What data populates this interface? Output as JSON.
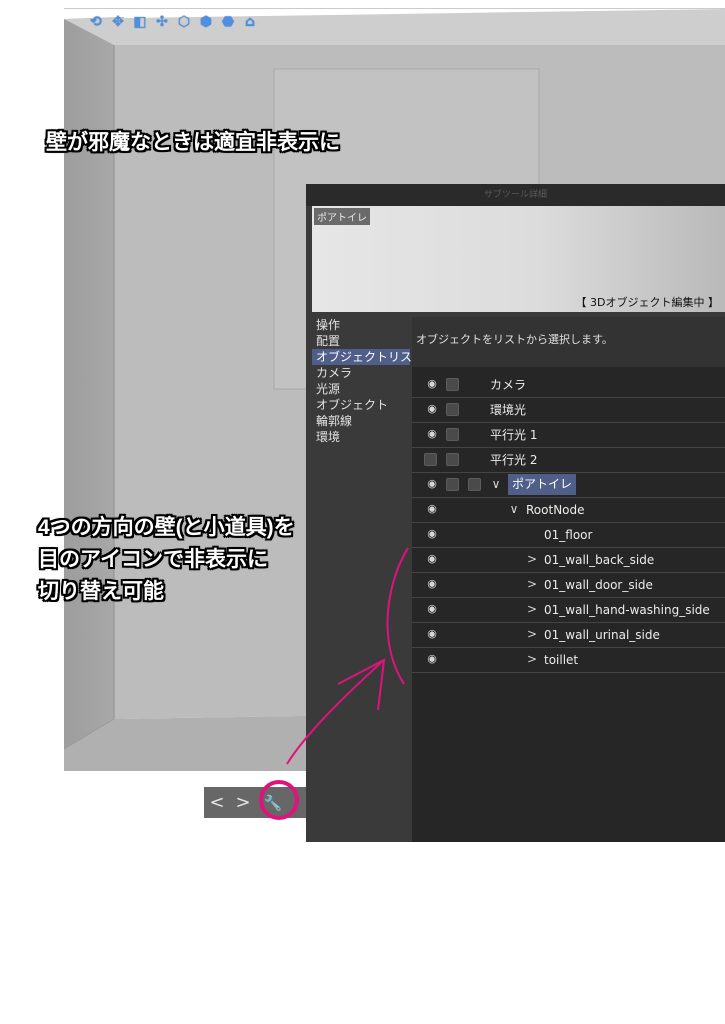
{
  "toolbar_icons": [
    "camera-move-icon",
    "pan-icon",
    "zoom-icon",
    "rotate-icon",
    "object-rotate-icon",
    "object-pan-icon",
    "object-zoom-icon",
    "object-reset-icon"
  ],
  "captions": {
    "top": "壁が邪魔なときは適宜非表示に",
    "lines": [
      "4つの方向の壁(と小道具)を",
      "目のアイコンで非表示に",
      "切り替え可能"
    ]
  },
  "nav": {
    "prev": "<",
    "next": ">",
    "wrench": "wrench-icon"
  },
  "panel": {
    "title": "サブツール詳細",
    "preview_tag": "ポアトイレ",
    "preview_status": "【 3Dオブジェクト編集中 】",
    "categories": [
      {
        "label": "操作",
        "selected": false
      },
      {
        "label": "配置",
        "selected": false
      },
      {
        "label": "オブジェクトリスト",
        "selected": true
      },
      {
        "label": "カメラ",
        "selected": false
      },
      {
        "label": "光源",
        "selected": false
      },
      {
        "label": "オブジェクト",
        "selected": false
      },
      {
        "label": "輪郭線",
        "selected": false
      },
      {
        "label": "環境",
        "selected": false
      }
    ],
    "hint": "オブジェクトをリストから選択します。",
    "objects": [
      {
        "label": "カメラ",
        "eye": true,
        "boxes": 1,
        "chevron": "",
        "indent": 0,
        "selected": false
      },
      {
        "label": "環境光",
        "eye": true,
        "boxes": 1,
        "chevron": "",
        "indent": 0,
        "selected": false
      },
      {
        "label": "平行光 1",
        "eye": true,
        "boxes": 1,
        "chevron": "",
        "indent": 0,
        "selected": false
      },
      {
        "label": "平行光 2",
        "eye": false,
        "boxes": 2,
        "chevron": "",
        "indent": 0,
        "selected": false
      },
      {
        "label": "ポアトイレ",
        "eye": true,
        "boxes": 2,
        "chevron": "down",
        "indent": 0,
        "selected": true
      },
      {
        "label": "RootNode",
        "eye": true,
        "boxes": 0,
        "chevron": "down",
        "indent": 1,
        "selected": false
      },
      {
        "label": "01_floor",
        "eye": true,
        "boxes": 0,
        "chevron": "",
        "indent": 2,
        "selected": false
      },
      {
        "label": "01_wall_back_side",
        "eye": true,
        "boxes": 0,
        "chevron": "right",
        "indent": 2,
        "selected": false
      },
      {
        "label": "01_wall_door_side",
        "eye": true,
        "boxes": 0,
        "chevron": "right",
        "indent": 2,
        "selected": false
      },
      {
        "label": "01_wall_hand-washing_side",
        "eye": true,
        "boxes": 0,
        "chevron": "right",
        "indent": 2,
        "selected": false
      },
      {
        "label": "01_wall_urinal_side",
        "eye": true,
        "boxes": 0,
        "chevron": "right",
        "indent": 2,
        "selected": false
      },
      {
        "label": "toillet",
        "eye": true,
        "boxes": 0,
        "chevron": "right",
        "indent": 2,
        "selected": false
      }
    ]
  },
  "colors": {
    "highlight": "#e0137c",
    "selection": "#4f5f8a"
  }
}
